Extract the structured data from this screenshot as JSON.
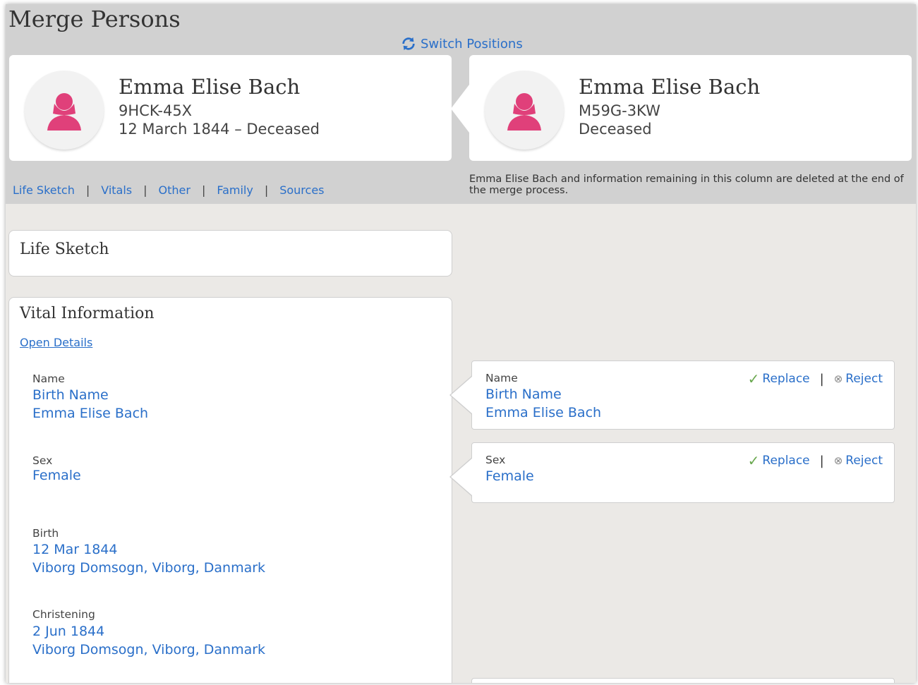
{
  "page": {
    "title": "Merge Persons"
  },
  "switch": {
    "label": "Switch Positions",
    "icon": "switch-icon"
  },
  "left_person": {
    "name": "Emma Elise Bach",
    "id": "9HCK-45X",
    "lifespan": "12 March 1844 – Deceased"
  },
  "right_person": {
    "name": "Emma Elise Bach",
    "id": "M59G-3KW",
    "lifespan": "Deceased"
  },
  "nav": {
    "items": [
      "Life Sketch",
      "Vitals",
      "Other",
      "Family",
      "Sources"
    ],
    "separator": "|"
  },
  "delete_note": "Emma Elise Bach and information remaining in this column are deleted at the end of the merge process.",
  "life_sketch": {
    "title": "Life Sketch"
  },
  "vital": {
    "title": "Vital Information",
    "open_details": "Open Details",
    "fields": [
      {
        "label": "Name",
        "line1": "Birth Name",
        "line2": "Emma Elise Bach"
      },
      {
        "label": "Sex",
        "line1": "Female"
      },
      {
        "label": "Birth",
        "line1": "12 Mar 1844",
        "line2": "Viborg Domsogn, Viborg, Danmark"
      },
      {
        "label": "Christening",
        "line1": "2 Jun 1844",
        "line2": "Viborg Domsogn, Viborg, Danmark"
      }
    ]
  },
  "compare": {
    "name": {
      "label": "Name",
      "line1": "Birth Name",
      "line2": "Emma Elise Bach"
    },
    "sex": {
      "label": "Sex",
      "line1": "Female"
    },
    "replace_label": "Replace",
    "reject_label": "Reject",
    "separator": "|"
  },
  "colors": {
    "accent": "#2a6fc9",
    "avatar": "#e0407a",
    "check": "#6aa84f",
    "header_bg": "#d1d1d1"
  }
}
